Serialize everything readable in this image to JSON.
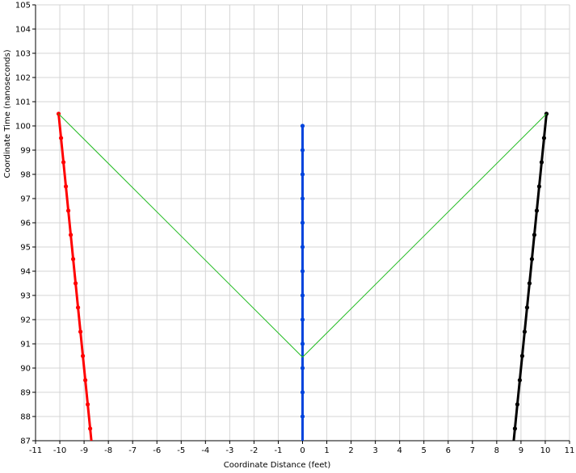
{
  "chart_data": {
    "type": "line",
    "title": "",
    "xlabel": "Coordinate Distance (feet)",
    "ylabel": "Coordinate Time (nanoseconds)",
    "xlim": [
      -11,
      11
    ],
    "ylim": [
      87,
      105
    ],
    "x_ticks": [
      -11,
      -10,
      -9,
      -8,
      -7,
      -6,
      -5,
      -4,
      -3,
      -2,
      -1,
      0,
      1,
      2,
      3,
      4,
      5,
      6,
      7,
      8,
      9,
      10,
      11
    ],
    "y_ticks": [
      87,
      88,
      89,
      90,
      91,
      92,
      93,
      94,
      95,
      96,
      97,
      98,
      99,
      100,
      101,
      102,
      103,
      104,
      105
    ],
    "grid": true,
    "series": [
      {
        "color": "#ff0000",
        "markers": true,
        "points": [
          {
            "x": -10.05,
            "y": 100.5
          },
          {
            "x": -9.95,
            "y": 99.5
          },
          {
            "x": -9.85,
            "y": 98.5
          },
          {
            "x": -9.75,
            "y": 97.5
          },
          {
            "x": -9.65,
            "y": 96.5
          },
          {
            "x": -9.55,
            "y": 95.5
          },
          {
            "x": -9.45,
            "y": 94.5
          },
          {
            "x": -9.35,
            "y": 93.5
          },
          {
            "x": -9.25,
            "y": 92.5
          },
          {
            "x": -9.15,
            "y": 91.5
          },
          {
            "x": -9.05,
            "y": 90.5
          },
          {
            "x": -8.95,
            "y": 89.5
          },
          {
            "x": -8.85,
            "y": 88.5
          },
          {
            "x": -8.75,
            "y": 87.5
          },
          {
            "x": -8.7,
            "y": 87.0
          }
        ]
      },
      {
        "color": "#0044dd",
        "markers": true,
        "points": [
          {
            "x": 0,
            "y": 100
          },
          {
            "x": 0,
            "y": 99
          },
          {
            "x": 0,
            "y": 98
          },
          {
            "x": 0,
            "y": 97
          },
          {
            "x": 0,
            "y": 96
          },
          {
            "x": 0,
            "y": 95
          },
          {
            "x": 0,
            "y": 94
          },
          {
            "x": 0,
            "y": 93
          },
          {
            "x": 0,
            "y": 92
          },
          {
            "x": 0,
            "y": 91
          },
          {
            "x": 0,
            "y": 90
          },
          {
            "x": 0,
            "y": 89
          },
          {
            "x": 0,
            "y": 88
          },
          {
            "x": 0,
            "y": 87
          }
        ]
      },
      {
        "color": "#000000",
        "markers": true,
        "points": [
          {
            "x": 10.05,
            "y": 100.5
          },
          {
            "x": 9.95,
            "y": 99.5
          },
          {
            "x": 9.85,
            "y": 98.5
          },
          {
            "x": 9.75,
            "y": 97.5
          },
          {
            "x": 9.65,
            "y": 96.5
          },
          {
            "x": 9.55,
            "y": 95.5
          },
          {
            "x": 9.45,
            "y": 94.5
          },
          {
            "x": 9.35,
            "y": 93.5
          },
          {
            "x": 9.25,
            "y": 92.5
          },
          {
            "x": 9.15,
            "y": 91.5
          },
          {
            "x": 9.05,
            "y": 90.5
          },
          {
            "x": 8.95,
            "y": 89.5
          },
          {
            "x": 8.85,
            "y": 88.5
          },
          {
            "x": 8.75,
            "y": 87.5
          },
          {
            "x": 8.7,
            "y": 87.0
          }
        ]
      },
      {
        "color": "#22bb22",
        "markers": false,
        "points": [
          {
            "x": -10.05,
            "y": 100.5
          },
          {
            "x": 0,
            "y": 90.45
          },
          {
            "x": 10.05,
            "y": 100.5
          }
        ]
      }
    ]
  }
}
